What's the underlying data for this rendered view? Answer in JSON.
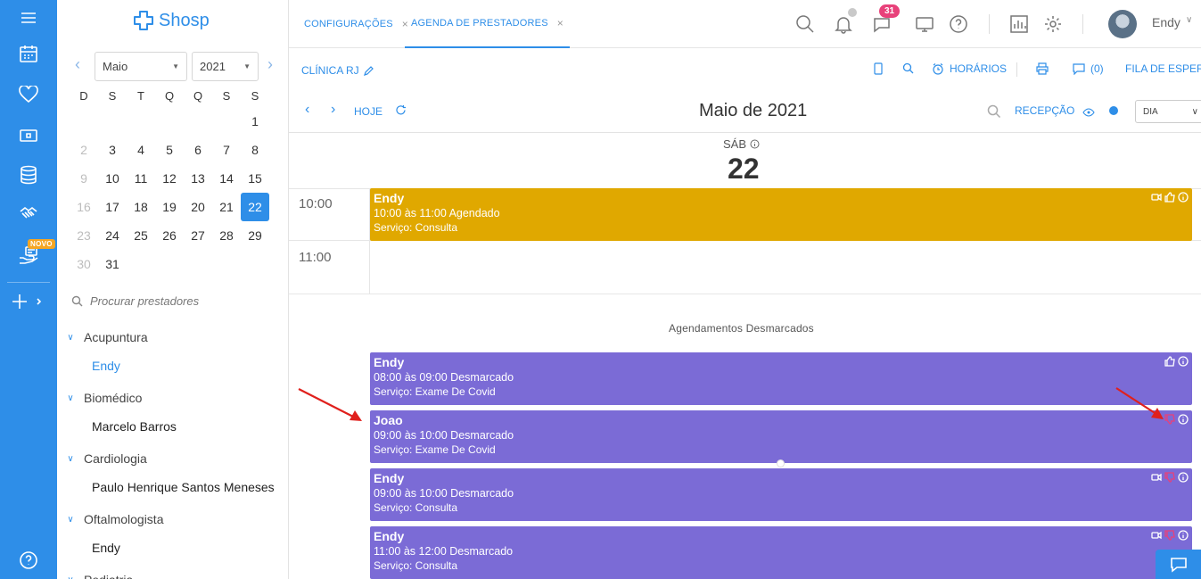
{
  "brand": {
    "name": "Shosp",
    "color": "#2e8ee8"
  },
  "rail": {
    "items": [
      {
        "icon": "menu-icon"
      },
      {
        "icon": "calendar-icon"
      },
      {
        "icon": "heart-icon"
      },
      {
        "icon": "money-icon"
      },
      {
        "icon": "database-icon"
      },
      {
        "icon": "handshake-icon"
      },
      {
        "icon": "hand-card-icon",
        "badge": "NOVO"
      },
      {
        "icon": "plus-icon"
      },
      {
        "icon": "help-icon"
      }
    ]
  },
  "tabs": [
    {
      "label": "CONFIGURAÇÕES",
      "close": "×"
    },
    {
      "label": "AGENDA DE PRESTADORES",
      "close": "×",
      "active": true
    }
  ],
  "header": {
    "notifications_badge": "31",
    "user_name": "Endy"
  },
  "mini_calendar": {
    "month": "Maio",
    "year": "2021",
    "weekdays": [
      "D",
      "S",
      "T",
      "Q",
      "Q",
      "S",
      "S"
    ],
    "weeks": [
      [
        "",
        "",
        "",
        "",
        "",
        "",
        "1"
      ],
      [
        "2",
        "3",
        "4",
        "5",
        "6",
        "7",
        "8"
      ],
      [
        "9",
        "10",
        "11",
        "12",
        "13",
        "14",
        "15"
      ],
      [
        "16",
        "17",
        "18",
        "19",
        "20",
        "21",
        "22"
      ],
      [
        "23",
        "24",
        "25",
        "26",
        "27",
        "28",
        "29"
      ],
      [
        "30",
        "31",
        "",
        "",
        "",
        "",
        ""
      ]
    ],
    "selected_day": "22"
  },
  "provider_search": {
    "placeholder": "Procurar prestadores"
  },
  "specialties": [
    {
      "name": "Acupuntura",
      "providers": [
        {
          "name": "Endy",
          "active": true
        }
      ]
    },
    {
      "name": "Biomédico",
      "providers": [
        {
          "name": "Marcelo Barros"
        }
      ]
    },
    {
      "name": "Cardiologia",
      "providers": [
        {
          "name": "Paulo Henrique Santos Meneses"
        }
      ]
    },
    {
      "name": "Oftalmologista",
      "providers": [
        {
          "name": "Endy"
        }
      ]
    },
    {
      "name": "Pediatria",
      "providers": []
    }
  ],
  "toolbar": {
    "clinic": "CLÍNICA RJ",
    "horarios": "HORÁRIOS",
    "messages": "(0)",
    "waitlist": "FILA DE ESPERA",
    "today": "HOJE",
    "period_title": "Maio de 2021",
    "reception": "RECEPÇÃO",
    "view": "DIA"
  },
  "day_view": {
    "day_name": "SÁB",
    "day_number": "22",
    "time_slots": [
      "10:00",
      "11:00"
    ],
    "scheduled": [
      {
        "name": "Endy",
        "time": "10:00 às 11:00 Agendado",
        "service": "Serviço: Consulta",
        "color": "#e0a800"
      }
    ],
    "cancelled_title": "Agendamentos Desmarcados",
    "cancelled": [
      {
        "name": "Endy",
        "time": "08:00 às 09:00 Desmarcado",
        "service": "Serviço: Exame De Covid",
        "color": "#7b6bd6"
      },
      {
        "name": "Joao",
        "time": "09:00 às 10:00 Desmarcado",
        "service": "Serviço: Exame De Covid",
        "color": "#7b6bd6"
      },
      {
        "name": "Endy",
        "time": "09:00 às 10:00 Desmarcado",
        "service": "Serviço: Consulta",
        "color": "#7b6bd6"
      },
      {
        "name": "Endy",
        "time": "11:00 às 12:00 Desmarcado",
        "service": "Serviço: Consulta",
        "color": "#7b6bd6"
      }
    ]
  }
}
